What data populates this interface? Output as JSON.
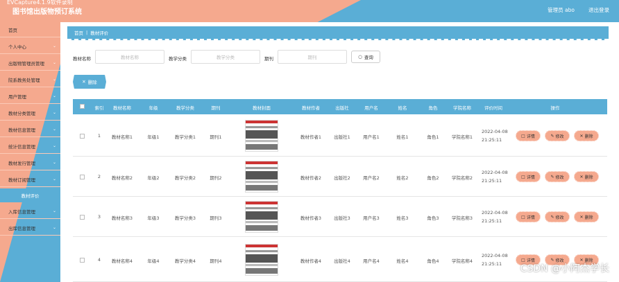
{
  "header": {
    "capture_title": "EVCapture4.1.9软件录制",
    "app_title": "图书馆出版物预订系统",
    "user": "管理员 abo",
    "logout": "退出登录"
  },
  "sidebar": {
    "items": [
      {
        "label": "首页",
        "has_chevron": false
      },
      {
        "label": "个人中心",
        "has_chevron": true
      },
      {
        "label": "出版物管理员管理",
        "has_chevron": true
      },
      {
        "label": "院系教务处管理",
        "has_chevron": true
      },
      {
        "label": "用户管理",
        "has_chevron": true
      },
      {
        "label": "教材分类管理",
        "has_chevron": true
      },
      {
        "label": "教材信息管理",
        "has_chevron": true
      },
      {
        "label": "统计信息管理",
        "has_chevron": true
      },
      {
        "label": "教材发行管理",
        "has_chevron": true
      },
      {
        "label": "教材订阅管理",
        "has_chevron": true
      }
    ],
    "subitem": "教材评价",
    "items_after": [
      {
        "label": "入库信息管理",
        "has_chevron": true
      },
      {
        "label": "出库信息管理",
        "has_chevron": true
      }
    ]
  },
  "breadcrumb": {
    "home": "首页",
    "current": "教材评价"
  },
  "search": {
    "fields": [
      {
        "label": "教材名称",
        "placeholder": "教材名称"
      },
      {
        "label": "教学分类",
        "placeholder": "教学分类"
      },
      {
        "label": "期刊",
        "placeholder": "期刊"
      }
    ],
    "button": "查询"
  },
  "delete_button": "删除",
  "table": {
    "headers": [
      "索引",
      "教材名称",
      "年级",
      "教学分类",
      "期刊",
      "教材封面",
      "教材作者",
      "出版社",
      "用户名",
      "姓名",
      "角色",
      "学院名称",
      "评价时间",
      "操作"
    ],
    "rows": [
      {
        "index": "1",
        "name": "教材名称1",
        "grade": "年级1",
        "category": "教学分类1",
        "journal": "期刊1",
        "author": "教材作者1",
        "publisher": "出版社1",
        "username": "用户名1",
        "realname": "姓名1",
        "role": "角色1",
        "college": "学院名称1",
        "time": "2022-04-08 21:25:11"
      },
      {
        "index": "2",
        "name": "教材名称2",
        "grade": "年级2",
        "category": "教学分类2",
        "journal": "期刊2",
        "author": "教材作者2",
        "publisher": "出版社2",
        "username": "用户名2",
        "realname": "姓名2",
        "role": "角色2",
        "college": "学院名称2",
        "time": "2022-04-08 21:25:11"
      },
      {
        "index": "3",
        "name": "教材名称3",
        "grade": "年级3",
        "category": "教学分类3",
        "journal": "期刊3",
        "author": "教材作者3",
        "publisher": "出版社3",
        "username": "用户名3",
        "realname": "姓名3",
        "role": "角色3",
        "college": "学院名称3",
        "time": "2022-04-08 21:25:11"
      },
      {
        "index": "4",
        "name": "教材名称4",
        "grade": "年级4",
        "category": "教学分类4",
        "journal": "期刊4",
        "author": "教材作者4",
        "publisher": "出版社4",
        "username": "用户名4",
        "realname": "姓名4",
        "role": "角色4",
        "college": "学院名称4",
        "time": "2022-04-08 21:25:11"
      }
    ],
    "actions": {
      "detail": "详情",
      "edit": "修改",
      "delete": "删除"
    }
  },
  "watermark": "CSDN @小阿杰学长",
  "icons": {
    "search": "search-icon",
    "delete": "trash-icon",
    "chevron": "chevron-down-icon",
    "detail": "detail-icon",
    "edit": "edit-icon"
  },
  "colors": {
    "salmon": "#f5a98e",
    "blue": "#5aaed6"
  }
}
